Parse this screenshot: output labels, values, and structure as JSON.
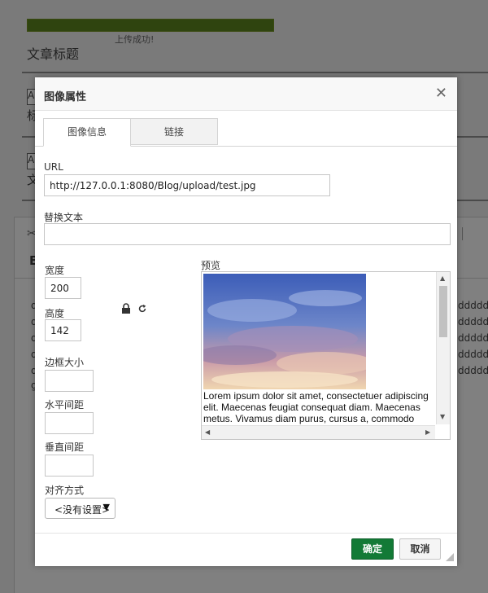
{
  "background": {
    "upload_message": "上传成功!",
    "article_title_label": "文章标题",
    "stub1": "A",
    "char1": "标",
    "stub2": "A",
    "char2": "文",
    "editor_heading": "B",
    "cut_glyph": "✂",
    "right_texts": [
      "dddddd",
      "dddddd",
      "dddddd",
      "dddddd",
      "dddddd"
    ],
    "left_texts": [
      "d",
      "d",
      "d",
      "d",
      "d",
      "g"
    ]
  },
  "dialog": {
    "title": "图像属性",
    "close_glyph": "✕",
    "tabs": [
      {
        "label": "图像信息",
        "active": true
      },
      {
        "label": "链接",
        "active": false
      }
    ],
    "url_label": "URL",
    "url_value": "http://127.0.0.1:8080/Blog/upload/test.jpg",
    "alt_label": "替换文本",
    "alt_value": "",
    "width_label": "宽度",
    "width_value": "200",
    "height_label": "高度",
    "height_value": "142",
    "border_label": "边框大小",
    "border_value": "",
    "hspace_label": "水平间距",
    "hspace_value": "",
    "vspace_label": "垂直间距",
    "vspace_value": "",
    "align_label": "对齐方式",
    "align_value": "<没有设置>",
    "preview_label": "预览",
    "preview_text": "Lorem ipsum dolor sit amet, consectetuer adipiscing elit. Maecenas feugiat consequat diam. Maecenas metus. Vivamus diam purus, cursus a, commodo",
    "ok_label": "确定",
    "cancel_label": "取消",
    "icons": {
      "lock": "lock-icon",
      "reset": "reset-size-icon",
      "close": "close-icon",
      "resize": "resize-grip-icon"
    }
  },
  "colors": {
    "ok_button": "#137a36",
    "upload_bar": "#2f440f"
  }
}
